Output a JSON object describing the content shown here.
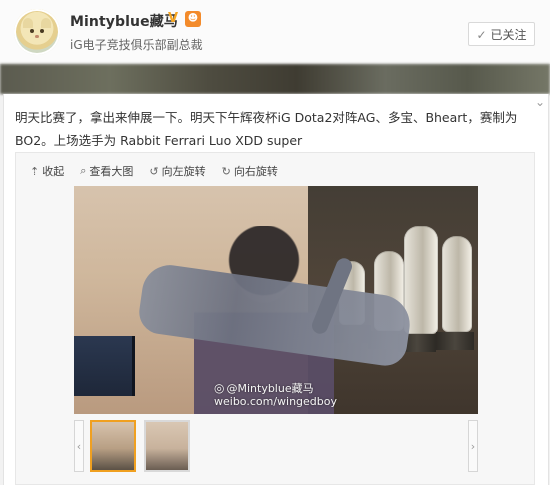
{
  "header": {
    "username": "Mintyblue藏马",
    "verified_badge": "V",
    "fan_badge_icon": "fan-badge-icon",
    "subtitle": "iG电子竞技俱乐部副总裁",
    "follow_button": "已关注",
    "follow_button_icon": "checkmark-icon"
  },
  "post": {
    "text": "明天比赛了，拿出来伸展一下。明天下午辉夜杯iG Dota2对阵AG、多宝、Bheart，赛制为BO2。上场选手为 Rabbit Ferrari Luo XDD super"
  },
  "media": {
    "tools": [
      {
        "label": "收起",
        "icon": "collapse-icon"
      },
      {
        "label": "查看大图",
        "icon": "zoom-icon"
      },
      {
        "label": "向左旋转",
        "icon": "rotate-left-icon"
      },
      {
        "label": "向右旋转",
        "icon": "rotate-right-icon"
      }
    ],
    "watermark": "@Mintyblue藏马\nweibo.com/wingedboy"
  },
  "colors": {
    "accent": "#f38b2b",
    "verified": "#f6a623",
    "thumb_selected_border": "#f0a020"
  }
}
